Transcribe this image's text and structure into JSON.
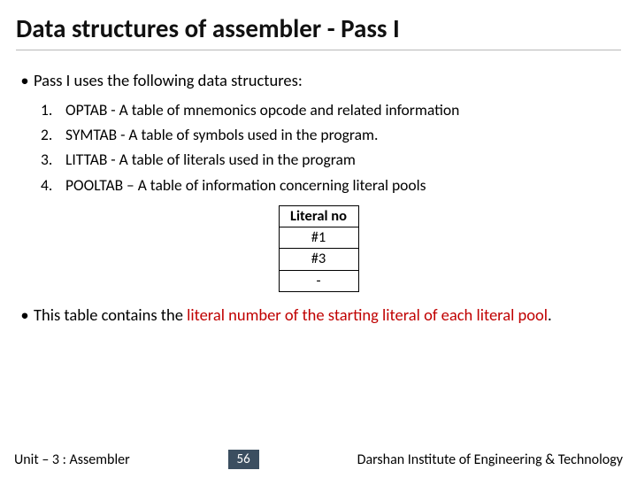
{
  "title": "Data structures of assembler - Pass I",
  "intro_bullet": "Pass I uses the following data structures:",
  "items": [
    {
      "n": "1.",
      "d": "OPTAB -  A table of mnemonics opcode and related information"
    },
    {
      "n": "2.",
      "d": "SYMTAB -  A table of symbols used in the program."
    },
    {
      "n": "3.",
      "d": "LITTAB - A table of literals used in the program"
    },
    {
      "n": "4.",
      "d": "POOLTAB – A table of information concerning literal pools"
    }
  ],
  "table": {
    "header": "Literal no",
    "rows": [
      "#1",
      "#3",
      "-"
    ]
  },
  "closing_prefix": "This table contains the ",
  "closing_highlight": "literal number of the starting literal of each literal pool",
  "closing_suffix": ".",
  "footer": {
    "left": "Unit – 3  : Assembler",
    "page": "56",
    "right": "Darshan Institute of Engineering & Technology"
  }
}
